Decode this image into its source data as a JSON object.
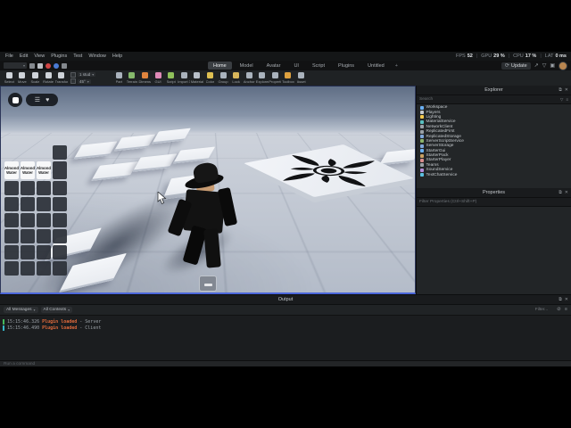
{
  "stats": {
    "items": [
      {
        "label": "FPS",
        "value": "52"
      },
      {
        "label": "GPU",
        "value": "29 %"
      },
      {
        "label": "CPU",
        "value": "17 %"
      },
      {
        "label": "LAT",
        "value": "0 ms"
      }
    ]
  },
  "menubar": {
    "items": [
      "File",
      "Edit",
      "View",
      "Plugins",
      "Test",
      "Window",
      "Help"
    ]
  },
  "tabbar": {
    "tabs": [
      "Home",
      "Model",
      "Avatar",
      "UI",
      "Script",
      "Plugins",
      "Untitled"
    ],
    "active": "Home",
    "new_tab": "+",
    "update_label": "Update",
    "update_icon": "⟳",
    "right_icons": [
      "↗",
      "▽",
      "▣"
    ]
  },
  "ribbon": {
    "tools_before": [
      {
        "label": "Select",
        "color": "#cfd4da"
      },
      {
        "label": "Move",
        "color": "#cfd4da"
      },
      {
        "label": "Scale",
        "color": "#cfd4da"
      },
      {
        "label": "Rotate",
        "color": "#cfd4da"
      },
      {
        "label": "Transform",
        "color": "#cfd4da"
      }
    ],
    "snap": {
      "rows": [
        "1 stud",
        "45°"
      ]
    },
    "tools_after": [
      {
        "label": "Part",
        "color": "#aab3bd"
      },
      {
        "label": "Terrain",
        "color": "#86ba6c"
      },
      {
        "label": "Dimension",
        "color": "#e0853e"
      },
      {
        "label": "GUI",
        "color": "#e08ab8"
      },
      {
        "label": "Script",
        "color": "#90c15b"
      },
      {
        "label": "Import 3D",
        "color": "#aab3bd"
      },
      {
        "label": "Material",
        "color": "#b9c1ca"
      },
      {
        "label": "Color",
        "color": "#dfc052"
      },
      {
        "label": "Group",
        "color": "#aab3bd"
      },
      {
        "label": "Lock",
        "color": "#d8b65b"
      },
      {
        "label": "Anchor",
        "color": "#aab3bd"
      },
      {
        "label": "Explorer",
        "color": "#aab3bd"
      },
      {
        "label": "Properties",
        "color": "#aab3bd"
      },
      {
        "label": "Toolbox",
        "color": "#dfa23f"
      },
      {
        "label": "Asset",
        "color": "#aab3bd"
      }
    ]
  },
  "viewport": {
    "hud": {
      "icons": [
        "☰",
        "♥"
      ]
    },
    "inventory": {
      "rows": 8,
      "cols": 4,
      "item_label": "Almond Water",
      "items": [
        [
          1,
          0
        ],
        [
          1,
          1
        ],
        [
          1,
          2
        ]
      ],
      "hidden_cells": [
        [
          0,
          0
        ],
        [
          0,
          1
        ],
        [
          0,
          2
        ]
      ]
    }
  },
  "explorer": {
    "title": "Explorer",
    "search_placeholder": "Search",
    "funnel_icon": "▽",
    "menu_icon": "≡",
    "items": [
      {
        "name": "Workspace",
        "color": "#6ab0f3"
      },
      {
        "name": "Players",
        "color": "#c5c9ce"
      },
      {
        "name": "Lighting",
        "color": "#f5c84c"
      },
      {
        "name": "MaterialService",
        "color": "#58c0c0"
      },
      {
        "name": "NetworkClient",
        "color": "#9aa0a6"
      },
      {
        "name": "ReplicatedFirst",
        "color": "#9aa0a6"
      },
      {
        "name": "ReplicatedStorage",
        "color": "#7fa7d9"
      },
      {
        "name": "ServerScriptService",
        "color": "#8cb46a"
      },
      {
        "name": "ServerStorage",
        "color": "#7fa7d9"
      },
      {
        "name": "StarterGui",
        "color": "#6ab0f3"
      },
      {
        "name": "StarterPack",
        "color": "#c9a063"
      },
      {
        "name": "StarterPlayer",
        "color": "#d98c8c"
      },
      {
        "name": "Teams",
        "color": "#9aa0a6"
      },
      {
        "name": "SoundService",
        "color": "#b48cd9"
      },
      {
        "name": "TextChatService",
        "color": "#5cc0e0"
      }
    ]
  },
  "properties": {
    "title": "Properties",
    "filter_placeholder": "Filter Properties (Ctrl+Shift+P)"
  },
  "panel": {
    "popout_icon": "⧉",
    "close_icon": "✕"
  },
  "output": {
    "title": "Output",
    "filters": [
      "All Messages",
      "All Contexts"
    ],
    "search_placeholder": "Filter...",
    "toolbar_icons": [
      "⊘",
      "≡"
    ],
    "message_color": "#e06a3c",
    "lines": [
      {
        "time": "15:15:46.326",
        "message": "Plugin loaded",
        "sep": "-",
        "context": "Server",
        "bar_color": "#45b85c"
      },
      {
        "time": "15:15:46.490",
        "message": "Plugin loaded",
        "sep": "-",
        "context": "Client",
        "bar_color": "#35b8c9"
      }
    ]
  },
  "command_bar": {
    "placeholder": "Run a command"
  }
}
